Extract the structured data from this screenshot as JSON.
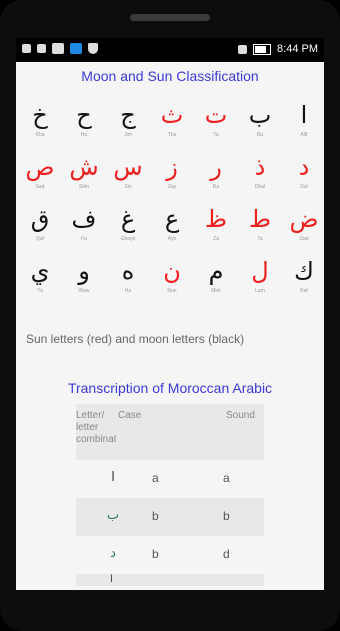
{
  "statusbar": {
    "time": "8:44 PM"
  },
  "screen": {
    "title": "Moon and Sun Classification",
    "letters": [
      [
        {
          "ch": "خ",
          "name": "Kha",
          "color": "black"
        },
        {
          "ch": "ح",
          "name": "Ha",
          "color": "black"
        },
        {
          "ch": "ج",
          "name": "Jim",
          "color": "black"
        },
        {
          "ch": "ث",
          "name": "Tha",
          "color": "red"
        },
        {
          "ch": "ت",
          "name": "Ta",
          "color": "red"
        },
        {
          "ch": "ب",
          "name": "Ba",
          "color": "black"
        },
        {
          "ch": "ا",
          "name": "Alif",
          "color": "black"
        }
      ],
      [
        {
          "ch": "ص",
          "name": "Sad",
          "color": "red"
        },
        {
          "ch": "ش",
          "name": "Shin",
          "color": "red"
        },
        {
          "ch": "س",
          "name": "Sin",
          "color": "red"
        },
        {
          "ch": "ز",
          "name": "Zay",
          "color": "red"
        },
        {
          "ch": "ر",
          "name": "Ra",
          "color": "red"
        },
        {
          "ch": "ذ",
          "name": "Dhal",
          "color": "red"
        },
        {
          "ch": "د",
          "name": "Dal",
          "color": "red"
        }
      ],
      [
        {
          "ch": "ق",
          "name": "Qaf",
          "color": "black"
        },
        {
          "ch": "ف",
          "name": "Fa",
          "color": "black"
        },
        {
          "ch": "غ",
          "name": "Ghayn",
          "color": "black"
        },
        {
          "ch": "ع",
          "name": "Ayn",
          "color": "black"
        },
        {
          "ch": "ظ",
          "name": "Za",
          "color": "red"
        },
        {
          "ch": "ط",
          "name": "Ta",
          "color": "red"
        },
        {
          "ch": "ض",
          "name": "Dad",
          "color": "red"
        }
      ],
      [
        {
          "ch": "ي",
          "name": "Ya",
          "color": "black"
        },
        {
          "ch": "و",
          "name": "Waw",
          "color": "black"
        },
        {
          "ch": "ه",
          "name": "Ha",
          "color": "black"
        },
        {
          "ch": "ن",
          "name": "Nun",
          "color": "red"
        },
        {
          "ch": "م",
          "name": "Mim",
          "color": "black"
        },
        {
          "ch": "ل",
          "name": "Lam",
          "color": "red"
        },
        {
          "ch": "ك",
          "name": "Kaf",
          "color": "black"
        }
      ]
    ],
    "caption": "Sun letters (red) and moon letters (black)",
    "section_title": "Transcription of Moroccan Arabic",
    "table": {
      "headers": [
        "Letter/ letter combinations",
        "Case",
        "Sound"
      ],
      "rows": [
        {
          "letter": "ا",
          "case": "a",
          "sound": "a"
        },
        {
          "letter": "ب",
          "case": "b",
          "sound": "b"
        },
        {
          "letter": "د",
          "case": "b",
          "sound": "d"
        }
      ],
      "cut_letter": "ا"
    }
  }
}
